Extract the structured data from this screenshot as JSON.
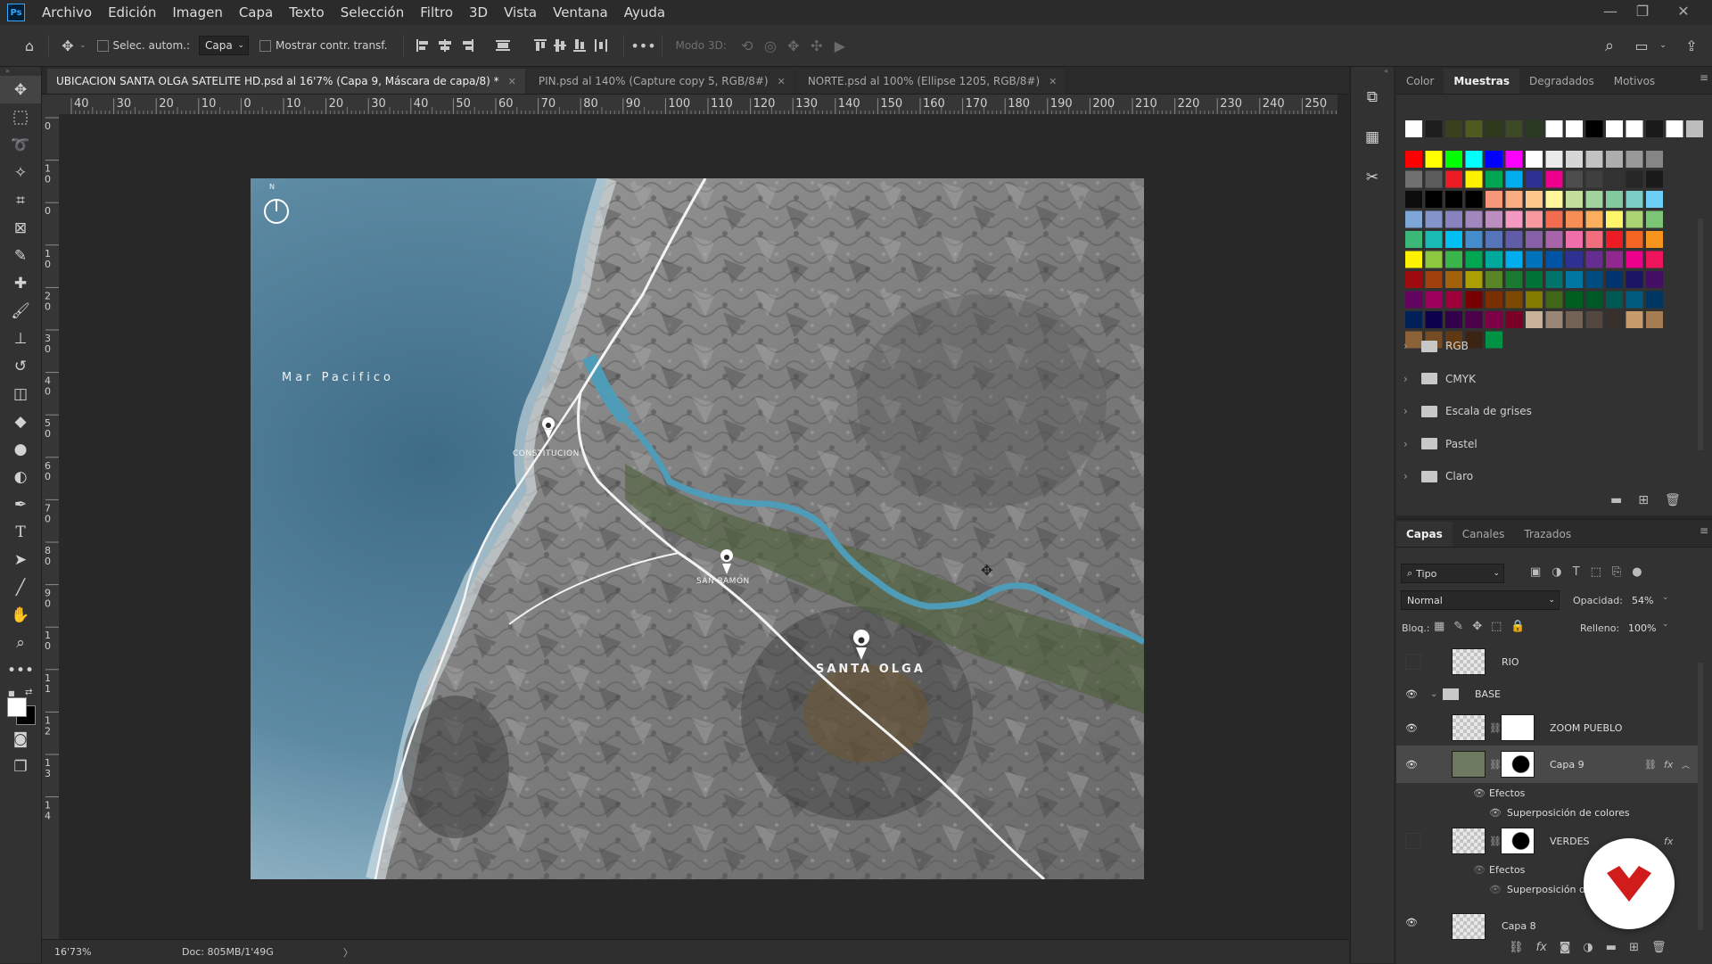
{
  "menubar": {
    "items": [
      "Archivo",
      "Edición",
      "Imagen",
      "Capa",
      "Texto",
      "Selección",
      "Filtro",
      "3D",
      "Vista",
      "Ventana",
      "Ayuda"
    ]
  },
  "options": {
    "auto_select_label": "Selec. autom.:",
    "auto_select_target": "Capa",
    "show_transform_label": "Mostrar contr. transf.",
    "mode_3d_label": "Modo 3D:"
  },
  "tabs": [
    {
      "label": "UBICACION SANTA OLGA SATELITE HD.psd al 16'7% (Capa 9, Máscara de capa/8) *",
      "active": true
    },
    {
      "label": "PIN.psd al 140% (Capture copy 5, RGB/8#)",
      "active": false
    },
    {
      "label": "NORTE.psd al 100% (Ellipse 1205, RGB/8#)",
      "active": false
    }
  ],
  "ruler_top_labels": [
    "40",
    "30",
    "20",
    "10",
    "0",
    "10",
    "20",
    "30",
    "40",
    "50",
    "60",
    "70",
    "80",
    "90",
    "100",
    "110",
    "120",
    "130",
    "140",
    "150",
    "160",
    "170",
    "180",
    "190",
    "200",
    "210",
    "220",
    "230",
    "240",
    "250"
  ],
  "ruler_left_labels": [
    "0",
    "1 0",
    "0",
    "1 0",
    "2 0",
    "3 0",
    "4 0",
    "5 0",
    "6 0",
    "7 0",
    "8 0",
    "9 0",
    "1 0",
    "1 1",
    "1 2",
    "1 3",
    "1 4"
  ],
  "map": {
    "north": "N",
    "sea_label": "Mar Pacifico",
    "town1": "CONSTITUCION",
    "town2": "SAN RAMON",
    "town3": "SANTA OLGA"
  },
  "status": {
    "zoom": "16'73%",
    "doc": "Doc: 805MB/1'49G",
    "arrow": "〉"
  },
  "swatch_panel": {
    "tabs": [
      "Color",
      "Muestras",
      "Degradados",
      "Motivos"
    ],
    "active_tab": "Muestras",
    "folders": [
      "RGB",
      "CMYK",
      "Escala de grises",
      "Pastel",
      "Claro"
    ],
    "recent": [
      "#ffffff",
      "#1e1e1e",
      "#3b3f1c",
      "#4f5a20",
      "#2f3a1c",
      "#3e4a25",
      "#2b3a22",
      "#ffffff",
      "#ffffff",
      "#000000",
      "#ffffff",
      "#ffffff",
      "#1a1a1a",
      "#ffffff",
      "#bdbdbd"
    ],
    "grid": [
      [
        "#ff0000",
        "#ffff00",
        "#00ff00",
        "#00ffff",
        "#0000ff",
        "#ff00ff",
        "#ffffff",
        "#ebebeb",
        "#d6d6d6",
        "#c2c2c2",
        "#adadad",
        "#999999",
        "#858585"
      ],
      [
        "#707070",
        "#5c5c5c",
        "#ed1c24",
        "#fff200",
        "#00a651",
        "#00aeef",
        "#2e3192",
        "#ec008c",
        "#4d4d4d",
        "#404040",
        "#333333",
        "#262626",
        "#1a1a1a"
      ],
      [
        "#0d0d0d",
        "#000000",
        "#000000",
        "#000000",
        "#f7977a",
        "#f9ad81",
        "#fdc68a",
        "#fff79a",
        "#c4df9b",
        "#a3d39c",
        "#82ca9d",
        "#7bcdc8",
        "#6ecff6"
      ],
      [
        "#7ea7d8",
        "#8493ca",
        "#8882be",
        "#a187be",
        "#bc8dbf",
        "#f49ac2",
        "#f6989d",
        "#f26c4f",
        "#f68e56",
        "#fbaf5d",
        "#fff568",
        "#acd372",
        "#7cc576"
      ],
      [
        "#3bb878",
        "#1abbb4",
        "#00bff3",
        "#448ccb",
        "#5574b9",
        "#605ca8",
        "#8560a8",
        "#a864a8",
        "#f06eaa",
        "#f26d7d",
        "#ed1c24",
        "#f26522",
        "#f7941d"
      ],
      [
        "#fff200",
        "#8dc63f",
        "#39b54a",
        "#00a651",
        "#00a99d",
        "#00aeef",
        "#0072bc",
        "#0054a6",
        "#2e3192",
        "#662d91",
        "#92278f",
        "#ec008c",
        "#ed145b"
      ],
      [
        "#9e0b0f",
        "#a0410d",
        "#a36209",
        "#aba000",
        "#598527",
        "#1a7b30",
        "#007236",
        "#00746b",
        "#0076a3",
        "#004b80",
        "#003471",
        "#1b1464",
        "#440e62"
      ],
      [
        "#630460",
        "#9e005d",
        "#9e0039",
        "#790000",
        "#7b2e00",
        "#7d4900",
        "#827b00",
        "#406618",
        "#005e20",
        "#005826",
        "#005952",
        "#005b7f",
        "#003663"
      ],
      [
        "#002157",
        "#0d004c",
        "#32004b",
        "#4b0049",
        "#7b0046",
        "#7a0026",
        "#c7b299",
        "#998675",
        "#736357",
        "#534741",
        "#37302d",
        "#c69c6d",
        "#a67c52"
      ],
      [
        "#8c6239",
        "#754c24",
        "#603913",
        "#3c2415",
        "#009245",
        "",
        ""
      ]
    ]
  },
  "layers_panel": {
    "tabs": [
      "Capas",
      "Canales",
      "Trazados"
    ],
    "active_tab": "Capas",
    "filter_label": "Tipo",
    "blend_mode": "Normal",
    "opacity_label": "Opacidad:",
    "opacity_value": "54%",
    "lock_label": "Bloq.:",
    "fill_label": "Relleno:",
    "fill_value": "100%",
    "layers": {
      "rio": "RIO",
      "base": "BASE",
      "zoom": "ZOOM PUEBLO",
      "capa9": "Capa 9",
      "efectos1": "Efectos",
      "superposicion1": "Superposición de colores",
      "verdes": "VERDES",
      "efectos2": "Efectos",
      "superposicion2": "Superposición de",
      "capa8": "Capa 8"
    }
  }
}
